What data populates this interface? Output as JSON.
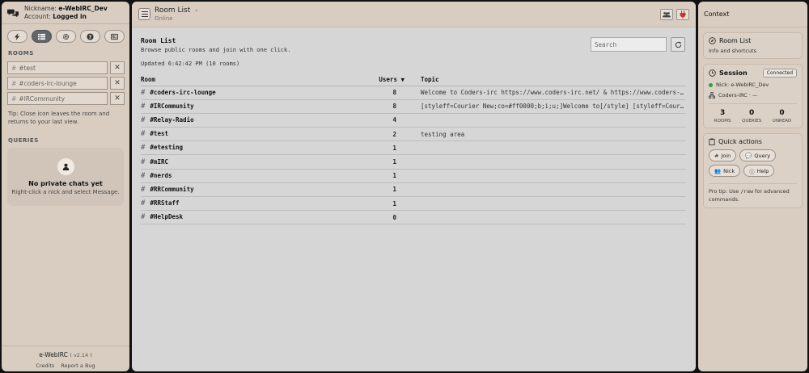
{
  "user": {
    "nickname_label": "Nickname:",
    "nickname": "e-WebIRC_Dev",
    "account_label": "Account:",
    "account": "Logged in"
  },
  "sidebar": {
    "rooms_heading": "ROOMS",
    "rooms": [
      {
        "name": "#test"
      },
      {
        "name": "#coders-irc-lounge"
      },
      {
        "name": "#IRCommunity"
      }
    ],
    "tip": "Tip: Close icon leaves the room and returns to your last view.",
    "queries_heading": "QUERIES",
    "empty_title": "No private chats yet",
    "empty_sub": "Right-click a nick and select Message.",
    "brand": "e-WebIRC",
    "version": "( v2.14 )",
    "credits": "Credits",
    "report": "Report a Bug"
  },
  "header": {
    "title": "Room List",
    "dash": "-",
    "status": "Online"
  },
  "main": {
    "title": "Room List",
    "description": "Browse public rooms and join with one click.",
    "updated": "Updated 6:42:42 PM  (10 rooms)",
    "search_placeholder": "Search",
    "col_room": "Room",
    "col_users": "Users ▼",
    "col_topic": "Topic",
    "rows": [
      {
        "room": "#coders-irc-lounge",
        "users": "8",
        "topic": "Welcome to Coders-irc https://www.coders-irc.net/ & https://www.coders-irc.net/chat"
      },
      {
        "room": "#IRCommunity",
        "users": "8",
        "topic": "[styleff=Courier New;co=#ff0000;b;i;u;]Welcome to[/style] [styleff=Courier New;co=#0000ff]IRCommunity"
      },
      {
        "room": "#Relay-Radio",
        "users": "4",
        "topic": ""
      },
      {
        "room": "#test",
        "users": "2",
        "topic": "testing area"
      },
      {
        "room": "#etesting",
        "users": "1",
        "topic": ""
      },
      {
        "room": "#mIRC",
        "users": "1",
        "topic": ""
      },
      {
        "room": "#nerds",
        "users": "1",
        "topic": ""
      },
      {
        "room": "#RRCommunity",
        "users": "1",
        "topic": ""
      },
      {
        "room": "#RRStaff",
        "users": "1",
        "topic": ""
      },
      {
        "room": "#HelpDesk",
        "users": "0",
        "topic": ""
      }
    ]
  },
  "context": {
    "title": "Context",
    "room_list_title": "Room List",
    "room_list_sub": "Info and shortcuts",
    "session_title": "Session",
    "session_badge": "Connected",
    "nick_line": "Nick: e-WebIRC_Dev",
    "network_line": "Coders-IRC · —",
    "stats": [
      {
        "n": "3",
        "l": "ROOMS"
      },
      {
        "n": "0",
        "l": "QUERIES"
      },
      {
        "n": "0",
        "l": "UNREAD"
      }
    ],
    "qa_title": "Quick actions",
    "qa": {
      "join": "Join",
      "query": "Query",
      "nick": "Nick",
      "help": "Help"
    },
    "protip_a": "Pro tip: Use ",
    "protip_code": "/raw",
    "protip_b": " for advanced commands."
  },
  "colors": {
    "panel": "#d9cdc1",
    "main_bg": "#d6d6d6",
    "active_tab": "#62656c",
    "connected": "#2f9e44"
  }
}
